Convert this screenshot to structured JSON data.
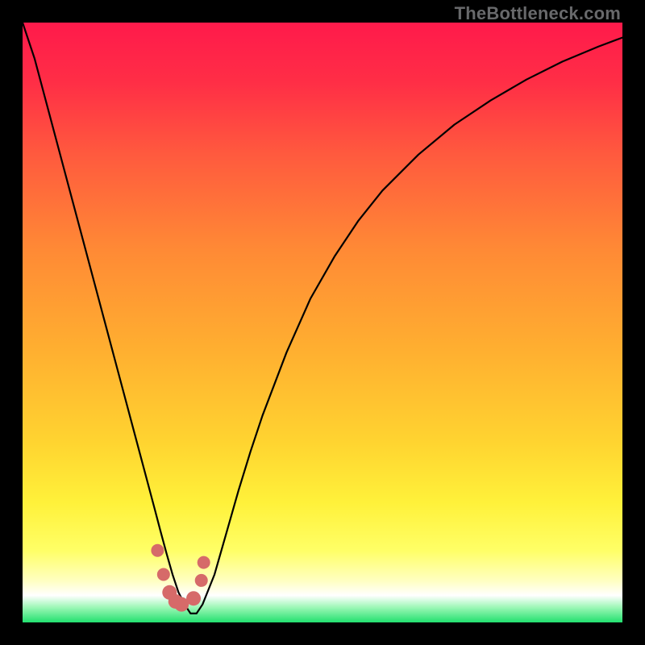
{
  "attribution": "TheBottleneck.com",
  "colors": {
    "frame": "#000000",
    "curve": "#000000",
    "markers": "#d66a69",
    "green_band": "#22e06f",
    "gradient_stops": [
      {
        "offset": 0.0,
        "color": "#ff1a4b"
      },
      {
        "offset": 0.1,
        "color": "#ff2e46"
      },
      {
        "offset": 0.22,
        "color": "#ff5a3e"
      },
      {
        "offset": 0.38,
        "color": "#ff8a35"
      },
      {
        "offset": 0.55,
        "color": "#ffb030"
      },
      {
        "offset": 0.7,
        "color": "#ffd430"
      },
      {
        "offset": 0.8,
        "color": "#fff13a"
      },
      {
        "offset": 0.88,
        "color": "#ffff66"
      },
      {
        "offset": 0.93,
        "color": "#ffffc0"
      },
      {
        "offset": 0.955,
        "color": "#ffffff"
      },
      {
        "offset": 0.975,
        "color": "#9cf7b6"
      },
      {
        "offset": 1.0,
        "color": "#22e06f"
      }
    ]
  },
  "chart_data": {
    "type": "line",
    "title": "",
    "xlabel": "",
    "ylabel": "",
    "xlim": [
      0,
      100
    ],
    "ylim": [
      0,
      100
    ],
    "x": [
      0,
      2,
      4,
      6,
      8,
      10,
      12,
      14,
      16,
      18,
      20,
      22,
      23,
      24,
      25,
      26,
      27,
      28,
      29,
      30,
      32,
      34,
      36,
      38,
      40,
      44,
      48,
      52,
      56,
      60,
      66,
      72,
      78,
      84,
      90,
      96,
      100
    ],
    "values": [
      100,
      94,
      86.5,
      79,
      71.5,
      64,
      56.5,
      49,
      41.5,
      34,
      26.5,
      19,
      15.2,
      11.5,
      8,
      5,
      3,
      1.5,
      1.5,
      3,
      8,
      15,
      22,
      28.5,
      34.5,
      45,
      54,
      61,
      67,
      72,
      78,
      83,
      87,
      90.5,
      93.5,
      96,
      97.5
    ],
    "markers": {
      "x": [
        22.5,
        23.5,
        24.5,
        25.5,
        26.5,
        28.5,
        29.8,
        30.2
      ],
      "y": [
        12,
        8,
        5,
        3.5,
        3,
        4,
        7,
        10
      ]
    }
  }
}
